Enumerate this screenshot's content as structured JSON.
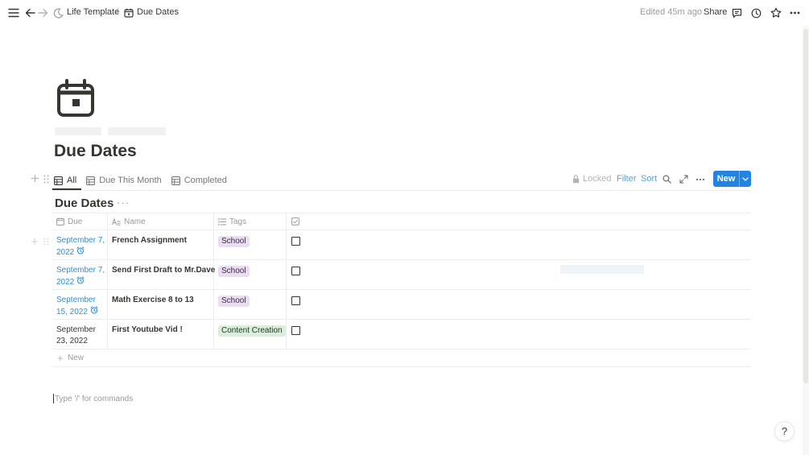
{
  "topbar": {
    "breadcrumbs": [
      {
        "label": "Life Template"
      },
      {
        "label": "Due Dates"
      }
    ],
    "separator": "/",
    "edited": "Edited 45m ago",
    "share_label": "Share",
    "icons": [
      "menu-icon",
      "back-arrow-icon",
      "forward-arrow-icon",
      "moon-icon",
      "calendar-icon",
      "comment-icon",
      "clock-icon",
      "star-icon",
      "more-icon"
    ]
  },
  "page": {
    "icon": "calendar-icon",
    "title": "Due Dates"
  },
  "views": {
    "tabs": [
      {
        "label": "All",
        "active": true
      },
      {
        "label": "Due This Month",
        "active": false
      },
      {
        "label": "Completed",
        "active": false
      }
    ],
    "locked_label": "Locked",
    "filter_label": "Filter",
    "sort_label": "Sort",
    "new_label": "New"
  },
  "database": {
    "title": "Due Dates",
    "more": "···",
    "columns": [
      {
        "label": "Due",
        "icon": "calendar-icon"
      },
      {
        "label": "Name",
        "icon": "text-icon"
      },
      {
        "label": "Tags",
        "icon": "list-icon"
      },
      {
        "label": "",
        "icon": "checkbox-icon"
      }
    ],
    "rows": [
      {
        "due_line1": "September 7,",
        "due_line2": "2022",
        "reminder": true,
        "name": "French Assignment",
        "tag": "School",
        "tag_kind": "school",
        "done": false
      },
      {
        "due_line1": "September 7,",
        "due_line2": "2022",
        "reminder": true,
        "name": "Send First Draft to Mr.Dave",
        "tag": "School",
        "tag_kind": "school",
        "done": false
      },
      {
        "due_line1": "September",
        "due_line2": "15, 2022",
        "reminder": true,
        "name": "Math Exercise 8 to 13",
        "tag": "School",
        "tag_kind": "school",
        "done": false
      },
      {
        "due_line1": "September",
        "due_line2": "23, 2022",
        "reminder": false,
        "name": "First Youtube Vid !",
        "tag": "Content Creation",
        "tag_kind": "content",
        "done": false
      }
    ],
    "new_row_label": "New"
  },
  "editor": {
    "placeholder": "Type '/' for commands"
  },
  "help_label": "?",
  "colors": {
    "accent": "#2383e2",
    "date_blue": "#2f8fd6",
    "tag_school_bg": "#e8deee",
    "tag_school_fg": "#412454",
    "tag_content_bg": "#dbeddb",
    "tag_content_fg": "#1c3829"
  }
}
